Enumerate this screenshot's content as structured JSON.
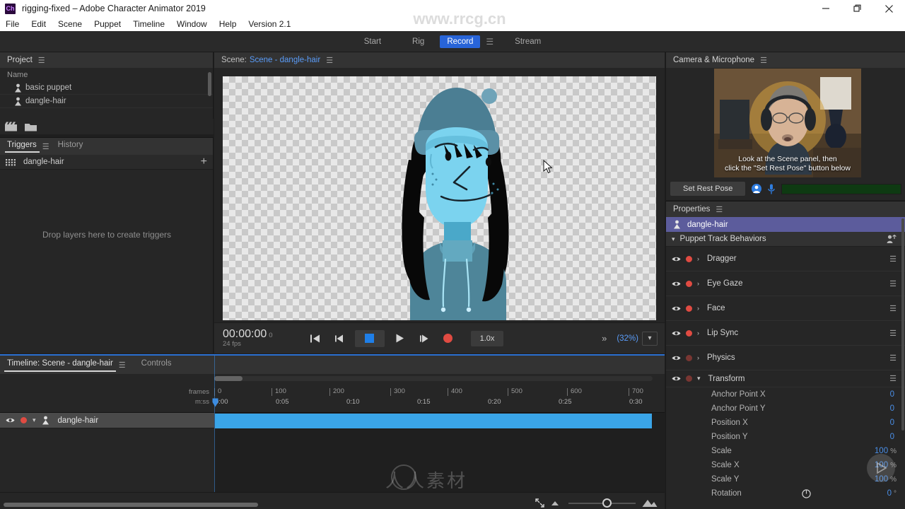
{
  "window": {
    "app_icon": "ch-logo-icon",
    "title": "rigging-fixed – Adobe Character Animator 2019",
    "minimize": "minimize-icon",
    "restore": "restore-icon",
    "close": "close-icon"
  },
  "menubar": {
    "items": [
      "File",
      "Edit",
      "Scene",
      "Puppet",
      "Timeline",
      "Window",
      "Help",
      "Version 2.1"
    ]
  },
  "workspace": {
    "tabs": [
      "Start",
      "Rig",
      "Record",
      "Stream"
    ],
    "active": "Record",
    "menu_icon": "hamburger-icon"
  },
  "watermarks": {
    "top": "www.rrcg.cn",
    "center": "人人素材"
  },
  "project": {
    "title": "Project",
    "menu_icon": "hamburger-icon",
    "column_header": "Name",
    "items": [
      {
        "name": "basic puppet",
        "icon": "puppet-icon"
      },
      {
        "name": "dangle-hair",
        "icon": "puppet-icon"
      }
    ],
    "footer_icons": [
      "new-scene-icon",
      "new-folder-icon"
    ]
  },
  "triggers": {
    "tabs": [
      "Triggers",
      "History"
    ],
    "active": "Triggers",
    "menu_icon": "hamburger-icon",
    "row": {
      "name": "dangle-hair",
      "icon": "grid-icon",
      "add": "+"
    },
    "empty_message": "Drop layers here to create triggers"
  },
  "scene": {
    "label": "Scene:",
    "name": "Scene - dangle-hair",
    "menu_icon": "hamburger-icon",
    "transport": {
      "timecode": "00:00:00",
      "frame": "0",
      "fps": "24 fps",
      "go_to_start": "skip-back-icon",
      "step_back": "step-back-icon",
      "stop": "stop-icon",
      "play": "play-icon",
      "step_forward": "step-forward-icon",
      "record": "record-icon",
      "speed": "1.0x",
      "more": "»",
      "zoom": "(32%)",
      "zoom_dropdown": "chevron-down-icon"
    }
  },
  "timeline": {
    "tabs": [
      "Timeline: Scene - dangle-hair",
      "Controls"
    ],
    "active": "Timeline: Scene - dangle-hair",
    "menu_icon": "hamburger-icon",
    "ruler": {
      "frames_label": "frames",
      "seconds_label": "m:ss",
      "frame_ticks": [
        "0",
        "100",
        "200",
        "300",
        "400",
        "500",
        "600",
        "700"
      ],
      "second_ticks": [
        "0:00",
        "0:05",
        "0:10",
        "0:15",
        "0:20",
        "0:25",
        "0:30"
      ]
    },
    "track": {
      "name": "dangle-hair",
      "visibility": "eye-icon",
      "arm": "record-icon",
      "expand": "chevron-down-icon",
      "type": "puppet-icon"
    },
    "zoom_small": "small-mountain-icon",
    "zoom_large": "large-mountain-icon",
    "fit_icon": "fit-to-screen-icon"
  },
  "camera": {
    "title": "Camera & Microphone",
    "menu_icon": "hamburger-icon",
    "overlay_line1": "Look at the Scene panel, then",
    "overlay_line2": "click the \"Set Rest Pose\" button below",
    "set_rest_pose": "Set Rest Pose",
    "camera_toggle": "camera-icon",
    "mic_toggle": "microphone-icon"
  },
  "properties": {
    "title": "Properties",
    "menu_icon": "hamburger-icon",
    "selected": {
      "name": "dangle-hair",
      "icon": "puppet-icon"
    },
    "group": {
      "label": "Puppet Track Behaviors",
      "add_icon": "add-behavior-icon",
      "expand": "chevron-down-icon"
    },
    "behaviors": [
      {
        "label": "Dragger",
        "visible": true,
        "armed": true,
        "expand": "chevron-right-icon",
        "menu": "hamburger-icon"
      },
      {
        "label": "Eye Gaze",
        "visible": true,
        "armed": true,
        "expand": "chevron-right-icon",
        "menu": "hamburger-icon"
      },
      {
        "label": "Face",
        "visible": true,
        "armed": true,
        "expand": "chevron-right-icon",
        "menu": "hamburger-icon"
      },
      {
        "label": "Lip Sync",
        "visible": true,
        "armed": true,
        "expand": "chevron-right-icon",
        "menu": "hamburger-icon"
      },
      {
        "label": "Physics",
        "visible": true,
        "armed": false,
        "expand": "chevron-right-icon",
        "menu": "hamburger-icon"
      }
    ],
    "transform": {
      "label": "Transform",
      "expand": "chevron-down-icon",
      "menu": "hamburger-icon",
      "rows": [
        {
          "label": "Anchor Point X",
          "value": "0",
          "unit": ""
        },
        {
          "label": "Anchor Point Y",
          "value": "0",
          "unit": ""
        },
        {
          "label": "Position X",
          "value": "0",
          "unit": ""
        },
        {
          "label": "Position Y",
          "value": "0",
          "unit": ""
        },
        {
          "label": "Scale",
          "value": "100",
          "unit": "%"
        },
        {
          "label": "Scale X",
          "value": "100",
          "unit": "%"
        },
        {
          "label": "Scale Y",
          "value": "100",
          "unit": "%"
        },
        {
          "label": "Rotation",
          "value": "0",
          "unit": "°"
        }
      ]
    }
  },
  "colors": {
    "accent_blue": "#2864d8",
    "link_blue": "#5a9cf8",
    "value_blue": "#4a8fe8",
    "record_red": "#e04b42",
    "clip_blue": "#3aa5e8",
    "selected_purple": "#5c5c9c",
    "panel_bg": "#262626",
    "header_bg": "#333333"
  }
}
